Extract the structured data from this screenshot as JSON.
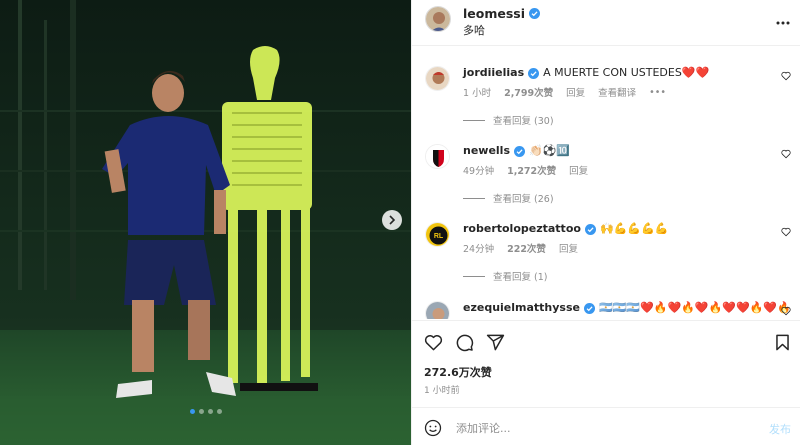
{
  "post": {
    "author": "leomessi",
    "location": "多哈",
    "carousel": {
      "slide_count": 4,
      "active_slide": 1
    },
    "likes_text": "272.6万次赞",
    "time_ago": "1 小时前"
  },
  "comments": [
    {
      "user": "jordiielias",
      "verified": true,
      "text": "A MUERTE CON USTEDES❤️❤️",
      "time": "1 小时",
      "likes": "2,799次赞",
      "reply": "回复",
      "translate": "查看翻译",
      "more": "•••",
      "view_replies": "查看回复 (30)"
    },
    {
      "user": "newells",
      "verified": true,
      "text": "👏🏻⚽🔟",
      "time": "49分钟",
      "likes": "1,272次赞",
      "reply": "回复",
      "view_replies": "查看回复 (26)"
    },
    {
      "user": "robertolopeztattoo",
      "verified": true,
      "text": "🙌💪💪💪💪",
      "time": "24分钟",
      "likes": "222次赞",
      "reply": "回复",
      "view_replies": "查看回复 (1)"
    },
    {
      "user": "ezequielmatthysse",
      "verified": true,
      "text": "🇦🇷🇦🇷🇦🇷❤️🔥❤️🔥❤️🔥❤️❤️🔥❤️🔥"
    }
  ],
  "composer": {
    "placeholder": "添加评论...",
    "post_label": "发布"
  },
  "icons": {
    "verified": "verified-badge-icon",
    "like": "heart-icon",
    "comment": "comment-icon",
    "share": "share-icon",
    "save": "bookmark-icon",
    "emoji": "emoji-icon",
    "more": "more-icon",
    "next": "chevron-right-icon"
  },
  "colors": {
    "accent": "#3897f0",
    "text": "#262626",
    "secondary": "#8e8e8e",
    "post_disabled": "#b2dffc"
  }
}
